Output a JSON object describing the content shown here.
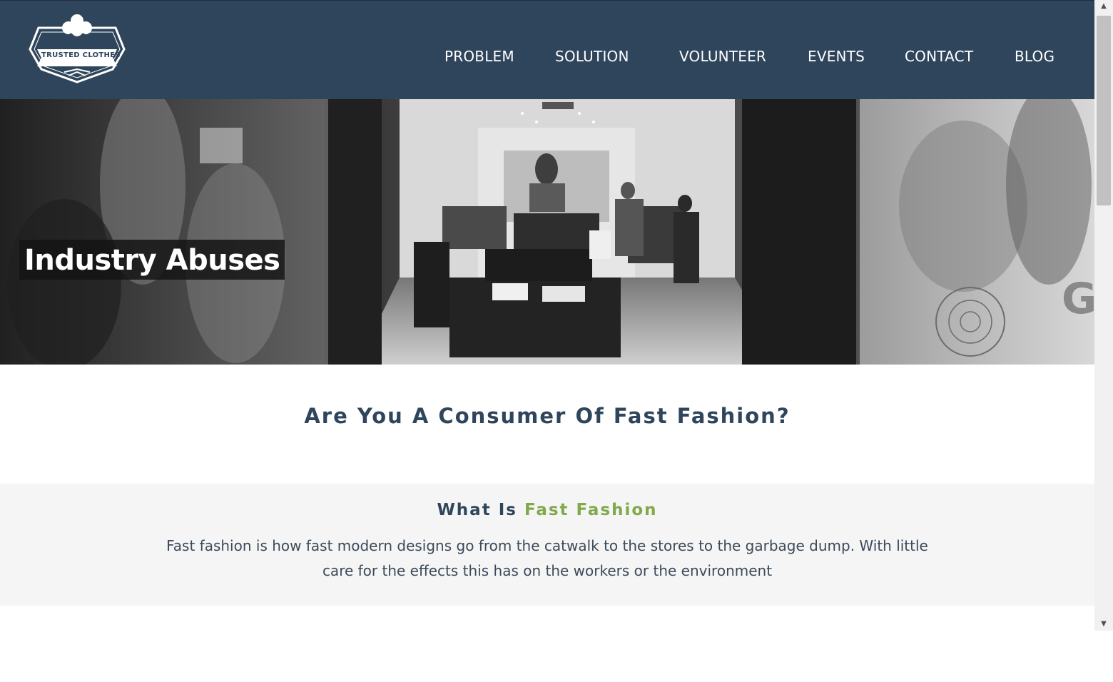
{
  "brand": {
    "logo_text": "TRUSTED CLOTHES"
  },
  "nav": [
    {
      "label": "PROBLEM"
    },
    {
      "label": "SOLUTION"
    },
    {
      "label": "VOLUNTEER"
    },
    {
      "label": "EVENTS"
    },
    {
      "label": "CONTACT"
    },
    {
      "label": "BLOG"
    }
  ],
  "hero": {
    "title": "Industry Abuses"
  },
  "section_consumer": {
    "heading": "Are You A Consumer Of Fast Fashion?"
  },
  "section_what": {
    "heading_prefix": "What Is ",
    "heading_accent": "Fast Fashion",
    "body": "Fast fashion is how fast modern designs go from the catwalk to the stores to the garbage dump. With little care for the effects this has on the workers or the environment"
  },
  "colors": {
    "header_bg": "#2f455c",
    "accent": "#7fa94a",
    "section_bg": "#f5f5f5"
  }
}
